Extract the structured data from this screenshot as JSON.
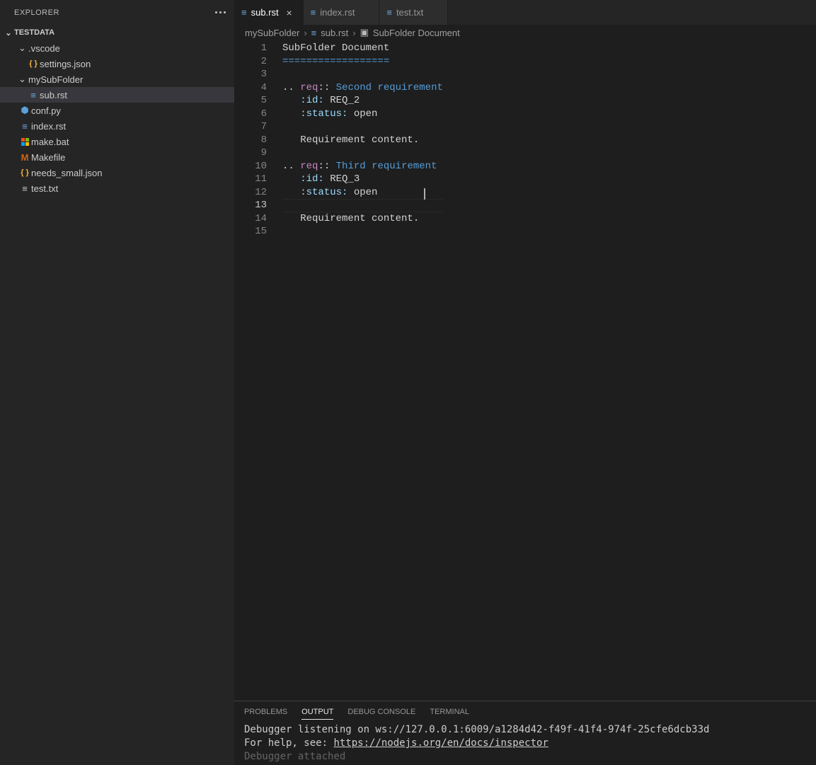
{
  "sidebar": {
    "title": "EXPLORER",
    "workspace": "TESTDATA",
    "items": [
      {
        "type": "folder",
        "open": true,
        "label": ".vscode",
        "depth": 1
      },
      {
        "type": "file",
        "icon": "json",
        "label": "settings.json",
        "depth": 2
      },
      {
        "type": "folder",
        "open": true,
        "label": "mySubFolder",
        "depth": 1
      },
      {
        "type": "file",
        "icon": "rst",
        "label": "sub.rst",
        "depth": 2,
        "selected": true
      },
      {
        "type": "file",
        "icon": "py",
        "label": "conf.py",
        "depth": 1
      },
      {
        "type": "file",
        "icon": "rst",
        "label": "index.rst",
        "depth": 1
      },
      {
        "type": "file",
        "icon": "win",
        "label": "make.bat",
        "depth": 1
      },
      {
        "type": "file",
        "icon": "make",
        "label": "Makefile",
        "depth": 1
      },
      {
        "type": "file",
        "icon": "json",
        "label": "needs_small.json",
        "depth": 1
      },
      {
        "type": "file",
        "icon": "txt",
        "label": "test.txt",
        "depth": 1
      }
    ]
  },
  "tabs": [
    {
      "label": "sub.rst",
      "icon": "rst",
      "active": true,
      "close": true
    },
    {
      "label": "index.rst",
      "icon": "rst",
      "active": false
    },
    {
      "label": "test.txt",
      "icon": "rst",
      "active": false
    }
  ],
  "breadcrumb": {
    "parts": [
      "mySubFolder",
      "sub.rst",
      "SubFolder Document"
    ]
  },
  "editor": {
    "current_line": 13,
    "lines": [
      {
        "n": 1,
        "tokens": [
          {
            "t": "SubFolder Document",
            "c": ""
          }
        ]
      },
      {
        "n": 2,
        "tokens": [
          {
            "t": "==================",
            "c": "c-teal"
          }
        ]
      },
      {
        "n": 3,
        "tokens": []
      },
      {
        "n": 4,
        "tokens": [
          {
            "t": ".. ",
            "c": ""
          },
          {
            "t": "req",
            "c": "c-purple"
          },
          {
            "t": ":: ",
            "c": ""
          },
          {
            "t": "Second requirement",
            "c": "c-title"
          }
        ]
      },
      {
        "n": 5,
        "tokens": [
          {
            "t": "   ",
            "c": ""
          },
          {
            "t": ":id:",
            "c": "c-key"
          },
          {
            "t": " REQ_2",
            "c": ""
          }
        ]
      },
      {
        "n": 6,
        "tokens": [
          {
            "t": "   ",
            "c": ""
          },
          {
            "t": ":status:",
            "c": "c-key"
          },
          {
            "t": " open",
            "c": ""
          }
        ]
      },
      {
        "n": 7,
        "tokens": []
      },
      {
        "n": 8,
        "tokens": [
          {
            "t": "   Requirement content.",
            "c": ""
          }
        ]
      },
      {
        "n": 9,
        "tokens": []
      },
      {
        "n": 10,
        "tokens": [
          {
            "t": ".. ",
            "c": ""
          },
          {
            "t": "req",
            "c": "c-purple"
          },
          {
            "t": ":: ",
            "c": ""
          },
          {
            "t": "Third requirement",
            "c": "c-title"
          }
        ]
      },
      {
        "n": 11,
        "tokens": [
          {
            "t": "   ",
            "c": ""
          },
          {
            "t": ":id:",
            "c": "c-key"
          },
          {
            "t": " REQ_3",
            "c": ""
          }
        ]
      },
      {
        "n": 12,
        "tokens": [
          {
            "t": "   ",
            "c": ""
          },
          {
            "t": ":status:",
            "c": "c-key"
          },
          {
            "t": " open",
            "c": ""
          }
        ]
      },
      {
        "n": 13,
        "tokens": []
      },
      {
        "n": 14,
        "tokens": [
          {
            "t": "   Requirement content.",
            "c": ""
          }
        ]
      },
      {
        "n": 15,
        "tokens": []
      }
    ]
  },
  "panel": {
    "tabs": [
      "PROBLEMS",
      "OUTPUT",
      "DEBUG CONSOLE",
      "TERMINAL"
    ],
    "active": "OUTPUT",
    "output": {
      "line1": "Debugger listening on ws://127.0.0.1:6009/a1284d42-f49f-41f4-974f-25cfe6dcb33d",
      "line2_pre": "For help, see: ",
      "line2_link": "https://nodejs.org/en/docs/inspector",
      "line3": "Debugger attached"
    }
  }
}
